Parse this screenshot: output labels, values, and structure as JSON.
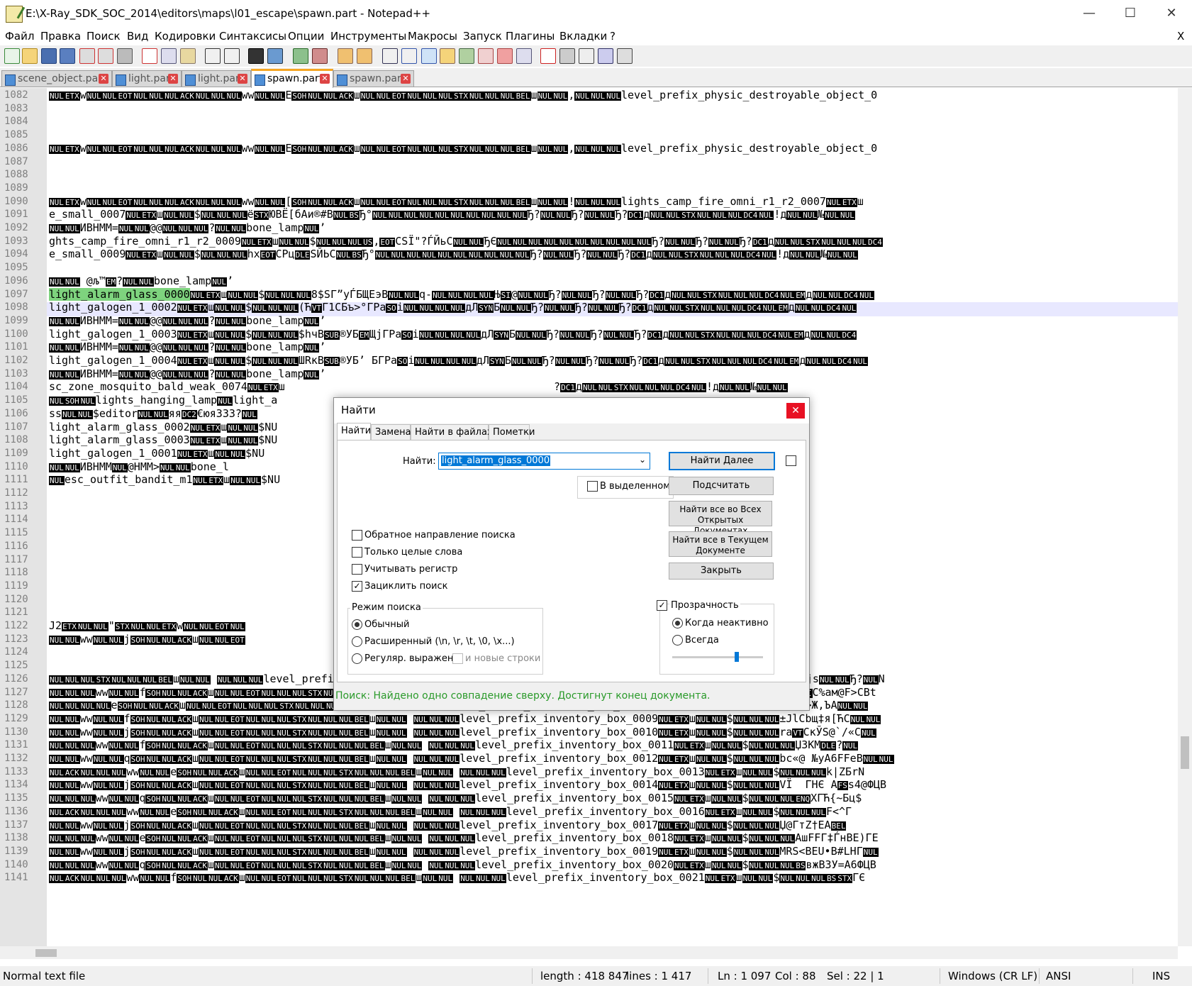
{
  "window": {
    "title": "E:\\X-Ray_SDK_SOC_2014\\editors\\maps\\l01_escape\\spawn.part - Notepad++",
    "minimize": "—",
    "maximize": "☐",
    "close": "✕"
  },
  "menu": [
    "Файл",
    "Правка",
    "Поиск",
    "Вид",
    "Кодировки",
    "Синтаксисы",
    "Опции",
    "Инструменты",
    "Макросы",
    "Запуск",
    "Плагины",
    "Вкладки",
    "?"
  ],
  "menu_close": "X",
  "tabs": [
    {
      "label": "scene_object.part",
      "active": false
    },
    {
      "label": "light.part",
      "active": false
    },
    {
      "label": "light.part",
      "active": false
    },
    {
      "label": "spawn.part",
      "active": true
    },
    {
      "label": "spawn.part",
      "active": false
    }
  ],
  "lines": [
    {
      "n": "1082",
      "text": "NULETXwNULNULEOTNULNULNULACKNULNULNULwwNULNULESOHNULNULACKшNULNULEOTNULNULNULSTXNULNULNULBELшNULNUL,NULNULNULlevel_prefix_physic_destroyable_object_0"
    },
    {
      "n": "1083",
      "text": ""
    },
    {
      "n": "1084",
      "text": ""
    },
    {
      "n": "1085",
      "text": ""
    },
    {
      "n": "1086",
      "text": "NULETXwNULNULEOTNULNULNULACKNULNULNULwwNULNULESOHNULNULACKшNULNULEOTNULNULNULSTXNULNULNULBELшNULNUL,NULNULNULlevel_prefix_physic_destroyable_object_0"
    },
    {
      "n": "1087",
      "text": ""
    },
    {
      "n": "1088",
      "text": ""
    },
    {
      "n": "1089",
      "text": ""
    },
    {
      "n": "1090",
      "text": "NULETXwNULNULEOTNULNULNULACKNULNULNULwwNULNUL[SOHNULNULACKшNULNULEOTNULNULNULSTXNULNULNULBELшNULNUL!NULNULNULlights_camp_fire_omni_r1_r2_0007NULETXш"
    },
    {
      "n": "1091",
      "text": "e_small_0007NULETXшNULNUL$NULNULNULёSTXЮВЁ[бАи®#ВNULBSЂ°NULNULNULNULNULNULNULNULNULNULЂ?NULNULЂ?NULNULЂ?DC1дNULNULSTXNULNULNULDC4NUL!дNULNUL№NULNUL"
    },
    {
      "n": "1092",
      "text": "NULNULИВНММ=NULNUL@@NULNULNUL?NULNULbone_lampNUL’"
    },
    {
      "n": "1093",
      "text": "ghts_camp_fire_omni_r1_r2_0009NULETXшNULNUL$NULNULNULUS,EOTCSЇ\"?ЃЙьCNULNULЂЄNULNULNULNULNULNULNULNULNULNULЂ?NULNULЂ?NULNULЂ?DC1дNULNULSTXNULNULNULDC4"
    },
    {
      "n": "1094",
      "text": "e_small_0009NULETXшNULNUL$NULNULNULhxEOTCPцDLEЅЙЬCNULBSЂ°NULNULNULNULNULNULNULNULNULNULЂ?NULNULЂ?NULNULЂ?DC1дNULNULSTXNULNULNULDC4NUL!дNULNUL№NULNUL"
    },
    {
      "n": "1095",
      "text": ""
    },
    {
      "n": "1096",
      "text": "NULNUL @љ™EM?NULNULbone_lampNUL’"
    },
    {
      "n": "1097",
      "text": "light_alarm_glass_0000NULETXшNULNUL$NULNULNUL8$SГ”уЃБЩЕэВNULNULq-NULNULNULNULЊSI@NULNULЂ?NULNULЂ?NULNULЂ?DC1дNULNULSTXNULNULNULDC4NULEMдNULNULDC4NUL"
    },
    {
      "n": "1098",
      "text": "light_galogen_1_0002NULETXшNULNUL$NULNULNUL(ЋVTГ1CБъ>°ГРаSOiNULNULNULNULдЛSYNБNULNULЂ?NULNULЂ?NULNULЂ?DC1дNULNULSTXNULNULNULDC4NULEMдNULNULDC4NUL"
    },
    {
      "n": "1099",
      "text": "NULNULИВНММ=NULNUL@@NULNULNUL?NULNULbone_lampNUL’"
    },
    {
      "n": "1100",
      "text": "light_galogen_1_0003NULETXшNULNUL$NULNULNUL$hчВSUB®УБEMЩјГРаSOiNULNULNULNULдЛSYNБNULNULЂ?NULNULЂ?NULNULЂ?DC1дNULNULSTXNULNULNULDC4NULEMдNULNULDC4"
    },
    {
      "n": "1101",
      "text": "NULNULИВНММ=NULNUL@@NULNULNUL?NULNULbone_lampNUL’"
    },
    {
      "n": "1102",
      "text": "light_galogen_1_0004NULETXшNULNUL$NULNULNULШRкВSUB®УБ’ БГРаSOiNULNULNULNULдЛSYNБNULNULЂ?NULNULЂ?NULNULЂ?DC1дNULNULSTXNULNULNULDC4NULEMдNULNULDC4NUL"
    },
    {
      "n": "1103",
      "text": "NULNULИВНММ=NULNUL@@NULNULNUL?NULNULbone_lampNUL’"
    },
    {
      "n": "1104",
      "text": "sc_zone_mosquito_bald_weak_0074NULETXш                                          ?DC1дNULNULSTXNULNULNULDC4NUL!дNULNUL№NULNUL"
    },
    {
      "n": "1105",
      "text": "NULSOHNULlights_hanging_lampNULlight_a"
    },
    {
      "n": "1106",
      "text": "ssNULNUL$editorNULNULяяDC2€юя333?NUL                                               lampNUL’"
    },
    {
      "n": "1107",
      "text": "light_alarm_glass_0002NULETXшNULNUL$NU                                        NULЂ?DC1дNULNULSTXNULNULNULDC4NULEMдNULNULDC4NU"
    },
    {
      "n": "1108",
      "text": "light_alarm_glass_0003NULETXшNULNUL$NU                                        NULЂ?DC1дNULNULSTXNULNULNULDC4NULEMдNULNULDC4"
    },
    {
      "n": "1109",
      "text": "light_galogen_1_0001NULETXшNULNUL$NU                                          DC1дNULNULSTXNULNULNULDC4NULEMдNULNULDC4NU"
    },
    {
      "n": "1110",
      "text": "NULNULИВНММNUL@HMM>NULNULbone_l"
    },
    {
      "n": "1111",
      "text": "NULesc_outfit_bandit_m1NULETXшNULNUL$NU                                       дNULNULSTXNULNULNULDC4NULEMдNULNULDC1NULNULNUL"
    },
    {
      "n": "1112",
      "text": ""
    },
    {
      "n": "1113",
      "text": ""
    },
    {
      "n": "1114",
      "text": ""
    },
    {
      "n": "1115",
      "text": ""
    },
    {
      "n": "1116",
      "text": ""
    },
    {
      "n": "1117",
      "text": ""
    },
    {
      "n": "1118",
      "text": ""
    },
    {
      "n": "1119",
      "text": ""
    },
    {
      "n": "1120",
      "text": ""
    },
    {
      "n": "1121",
      "text": ""
    },
    {
      "n": "1122",
      "text": "J2ETXNULNUL\"STXNULNULETXwNULNULEOTNUL                                         XNULNULNULBELшNULNUL!NULNULNULesc_zone_mosquito_b"
    },
    {
      "n": "1123",
      "text": "NULNULwwNULNULjSOHNULNULACKшNULNULEOT                                         box_0005NULETXшNULNUL$NULNULNULЎУVgВ‡ДАНETXFSC\"-Ђ"
    },
    {
      "n": "1124",
      "text": ""
    },
    {
      "n": "1125",
      "text": ""
    },
    {
      "n": "1126",
      "text": "NULNULNULSTXNULNULNULBELшNULNUL NULNULNULlevel_prefix_inventory_box_0006NULETXшNULNUL$NULNULNULTQ®CгцvAwЭгCNULNULNULNULNULNULNULNUL3SYNjsNULNULЂ?NULN"
    },
    {
      "n": "1127",
      "text": "NULNULNULwwNULNULfSOHNULNULACKшNULNULEOTNULNULNULSTXNULNULNULBELшNULNUL NULNULNULlevel_prefix_inventory_box_0007NULETXшNULNUL$NULNULNULMSIC%ам@F>CBt"
    },
    {
      "n": "1128",
      "text": "NULNULNULNULeSOHNULNULACKшNULNULEOTNULNULNULSTXNULNULNULBELшNULNUL NULNULNULlevel_prefix_inventory_box_0008NULETXшNULNUL$NULNULNULьНУВ,П>Ж,ЪАNULNUL"
    },
    {
      "n": "1129",
      "text": "NULNULwwNULNULfSOHNULNULACKшNULNULEOTNULNULNULSTXNULNULNULBELшNULNUL NULNULNULlevel_prefix_inventory_box_0009NULETXшNULNUL$NULNULNUL±JlCbщ‡я[ЋCNULNUL"
    },
    {
      "n": "1130",
      "text": "NULNULwwNULNULjSOHNULNULACKшNULNULEOTNULNULNULSTXNULNULNULBELшNULNUL NULNULNULlevel_prefix_inventory_box_0010NULETXшNULNUL$NULNULNULraVTCкЎЅ@`/«CNUL"
    },
    {
      "n": "1131",
      "text": "NULNULNULwwNULNULfSOHNULNULACKшNULNULEOTNULNULNULSTXNULNULNULBELшNULNUL NULNULNULlevel_prefix_inventory_box_0011NULETXшNULNUL$NULNULNULЏЗКМDLE?NUL"
    },
    {
      "n": "1132",
      "text": "NULNULwwNULNULqSOHNULNULACKшNULNULEOTNULNULNULSTXNULNULNULBELшNULNUL NULNULNULlevel_prefix_inventory_box_0012NULETXшNULNUL$NULNULNULbc«@ №уА6FFeBNULNUL"
    },
    {
      "n": "1133",
      "text": "NULACKNULNULNULwwNULNULeSOHNULNULACKшNULNULEOTNULNULNULSTXNULNULNULBELшNULNUL NULNULNULlevel_prefix_inventory_box_0013NULETXшNULNUL$NULNULNULk|ZБrN"
    },
    {
      "n": "1134",
      "text": "NULNULwwNULNULjSOHNULNULACKшNULNULEOTNULNULNULSTXNULNULNULBELшNULNUL NULNULNULlevel_prefix_inventory_box_0014NULETXшNULNUL$NULNULNULVЇ  ГНЄ AFSs4@ФЦВ"
    },
    {
      "n": "1135",
      "text": "NULNULNULwwNULNULqSOHNULNULACKшNULNULEOTNULNULNULSTXNULNULNULBELшNULNUL NULNULNULlevel_prefix_inventory_box_0015NULETXшNULNUL$NULNULNULENQXГЋ{~Бц$"
    },
    {
      "n": "1136",
      "text": "NULACKNULNULNULwwNULNULeSOHNULNULACKшNULNULEOTNULNULNULSTXNULNULNULBELшNULNUL NULNULNULlevel_prefix_inventory_box_0016NULETXшNULNUL$NULNULNULF<^Г"
    },
    {
      "n": "1137",
      "text": "NULNULwwNULNULjSOHNULNULACKшNULNULEOTNULNULNULSTXNULNULNULBELшNULNUL NULNULNULlevel_prefix_inventory_box_0017NULETXшNULNUL$NULNULNULЏ@ГтZ†ЕABEL"
    },
    {
      "n": "1138",
      "text": "NULNULNULwwNULNULeSOHNULNULACKшNULNULEOTNULNULNULSTXNULNULNULBELшNULNUL NULNULNULlevel_prefix_inventory_box_0018NULETXшNULNUL$NULNULNULAшFFГ‡ЃнВЕ)ГЕ"
    },
    {
      "n": "1139",
      "text": "NULNULwwNULNULjSOHNULNULACKшNULNULEOTNULNULNULSTXNULNULNULBELшNULNUL NULNULNULlevel_prefix_inventory_box_0019NULETXшNULNUL$NULNULNULMRS<BEU•В#LHГNUL"
    },
    {
      "n": "1140",
      "text": "NULNULNULwwNULNULqSOHNULNULACKшNULNULEOTNULNULNULSTXNULNULNULBELшNULNUL NULNULNULlevel_prefix_inventory_box_0020NULETXшNULNUL$NULNULNULBSвжВЗУ=А6ФЦВ"
    },
    {
      "n": "1141",
      "text": "NULACKNULNULNULwwNULNULfSOHNULNULACKшNULNULEOTNULNULNULSTXNULNULNULBELшNULNUL NULNULNULlevel_prefix_inventory_box_0021NULETXшNULNUL$NULNULNULBSSTXГЄ"
    }
  ],
  "find_dialog": {
    "title": "Найти",
    "close": "✕",
    "tabs": [
      "Найти",
      "Замена",
      "Найти в файлах",
      "Пометки"
    ],
    "find_label": "Найти:",
    "find_value": "light_alarm_glass_0000",
    "btn_find_next": "Найти Далее",
    "chk_in_selection": "В выделенном",
    "btn_count": "Подсчитать",
    "btn_find_all_open": "Найти все во Всех Открытых Документах",
    "btn_find_all_current": "Найти все в Текущем Документе",
    "btn_close": "Закрыть",
    "opt_backward": "Обратное направление поиска",
    "opt_whole_word": "Только целые слова",
    "opt_match_case": "Учитывать регистр",
    "opt_wrap": "Зациклить поиск",
    "search_mode_label": "Режим поиска",
    "mode_normal": "Обычный",
    "mode_extended": "Расширенный (\\n, \\r, \\t, \\0, \\x...)",
    "mode_regex": "Регуляр. выражен.",
    "opt_newlines": "и новые строки",
    "transparency_label": "Прозрачность",
    "trans_on_inactive": "Когда неактивно",
    "trans_always": "Всегда",
    "status_message": "Поиск: Найдено одно совпадение сверху. Достигнут конец документа."
  },
  "statusbar": {
    "type": "Normal text file",
    "length": "length : 418 847",
    "lines": "lines : 1 417",
    "ln": "Ln : 1 097",
    "col": "Col : 88",
    "sel": "Sel : 22 | 1",
    "eol": "Windows (CR LF)",
    "encoding": "ANSI",
    "mode": "INS"
  },
  "colors": {
    "match_highlight": "#7ed37e",
    "status_ok": "#2a9a2a",
    "active_tab_accent": "#f5a623"
  }
}
